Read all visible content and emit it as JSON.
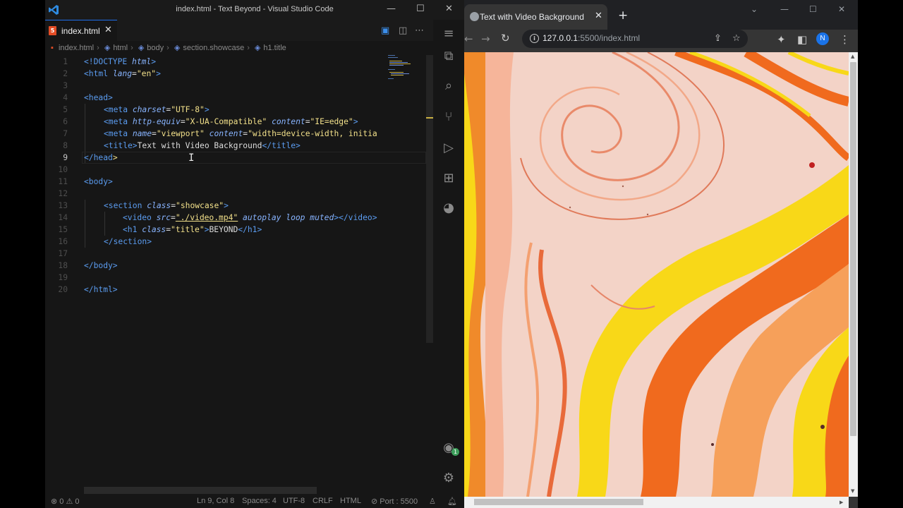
{
  "vscode": {
    "window_title": "index.html - Text Beyond - Visual Studio Code",
    "tab": {
      "label": "index.html",
      "close": "✕"
    },
    "breadcrumb": [
      "index.html",
      "html",
      "body",
      "section.showcase",
      "h1.title"
    ],
    "code_lines": [
      {
        "n": "1",
        "active": false
      },
      {
        "n": "2",
        "active": false
      },
      {
        "n": "3",
        "active": false
      },
      {
        "n": "4",
        "active": false
      },
      {
        "n": "5",
        "active": false
      },
      {
        "n": "6",
        "active": false
      },
      {
        "n": "7",
        "active": false
      },
      {
        "n": "8",
        "active": false
      },
      {
        "n": "9",
        "active": true
      },
      {
        "n": "10",
        "active": false
      },
      {
        "n": "11",
        "active": false
      },
      {
        "n": "12",
        "active": false
      },
      {
        "n": "13",
        "active": false
      },
      {
        "n": "14",
        "active": false
      },
      {
        "n": "15",
        "active": false
      },
      {
        "n": "16",
        "active": false
      },
      {
        "n": "17",
        "active": false
      },
      {
        "n": "18",
        "active": false
      },
      {
        "n": "19",
        "active": false
      },
      {
        "n": "20",
        "active": false
      }
    ],
    "code": {
      "l1_a": "<!DOCTYPE ",
      "l1_b": "html",
      "l1_c": ">",
      "l2_a": "<html ",
      "l2_b": "lang",
      "l2_c": "=",
      "l2_d": "\"en\"",
      "l2_e": ">",
      "l4": "<head>",
      "l5_a": "<meta ",
      "l5_b": "charset",
      "l5_c": "=",
      "l5_d": "\"UTF-8\"",
      "l5_e": ">",
      "l6_a": "<meta ",
      "l6_b": "http-equiv",
      "l6_c": "=",
      "l6_d": "\"X-UA-Compatible\"",
      "l6_e": " content",
      "l6_f": "=",
      "l6_g": "\"IE=edge\"",
      "l6_h": ">",
      "l7_a": "<meta ",
      "l7_b": "name",
      "l7_c": "=",
      "l7_d": "\"viewport\"",
      "l7_e": " content",
      "l7_f": "=",
      "l7_g": "\"width=device-width, initia",
      "l8_a": "<title>",
      "l8_b": "Text with Video Background",
      "l8_c": "</title>",
      "l9_a": "</head",
      "l9_b": ">",
      "l11": "<body>",
      "l13_a": "<section ",
      "l13_b": "class",
      "l13_c": "=",
      "l13_d": "\"showcase\"",
      "l13_e": ">",
      "l14_a": "<video ",
      "l14_b": "src",
      "l14_c": "=",
      "l14_d": "\"./video.mp4\"",
      "l14_e": " autoplay loop muted",
      "l14_f": "></video>",
      "l15_a": "<h1 ",
      "l15_b": "class",
      "l15_c": "=",
      "l15_d": "\"title\"",
      "l15_e": ">",
      "l15_f": "BEYOND",
      "l15_g": "</h1>",
      "l16": "</section>",
      "l18": "</body>",
      "l20": "</html>"
    },
    "status": {
      "errors": "0",
      "warnings": "0",
      "position": "Ln 9, Col 8",
      "spaces": "Spaces: 4",
      "encoding": "UTF-8",
      "eol": "CRLF",
      "language": "HTML",
      "port": "Port : 5500"
    },
    "accounts_badge": "1"
  },
  "browser": {
    "tab_title": "Text with Video Background",
    "url_host": "127.0.0.1",
    "url_rest": ":5500/index.html",
    "profile_initial": "N"
  },
  "colors": {
    "accent_blue": "#1f6feb",
    "html_icon": "#e44d26",
    "tag": "#5b9cf0",
    "attr": "#88b4ff",
    "string": "#f2e08a",
    "marble_orange": "#f06a1e",
    "marble_yellow": "#f8d818",
    "marble_pink": "#f2c6b8"
  }
}
